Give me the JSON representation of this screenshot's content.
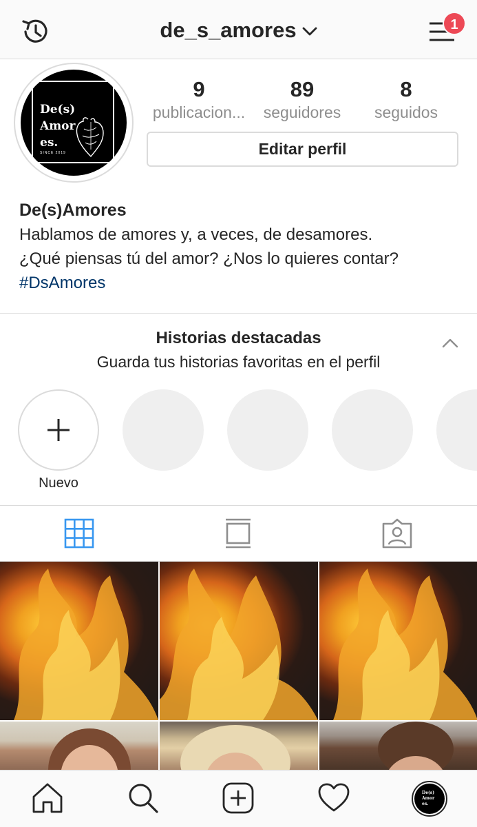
{
  "header": {
    "username": "de_s_amores",
    "notification_count": "1"
  },
  "profile": {
    "avatar_text_line1": "De(s)",
    "avatar_text_line2": "Amor",
    "avatar_text_line3": "es.",
    "avatar_since": "SINCE 2019",
    "stats": [
      {
        "value": "9",
        "label": "publicacion..."
      },
      {
        "value": "89",
        "label": "seguidores"
      },
      {
        "value": "8",
        "label": "seguidos"
      }
    ],
    "edit_button_label": "Editar perfil",
    "name": "De(s)Amores",
    "bio_line1": "Hablamos de amores y, a veces, de desamores.",
    "bio_line2": "¿Qué piensas tú del amor? ¿Nos lo quieres contar?",
    "hashtag": "#DsAmores"
  },
  "highlights": {
    "title": "Historias destacadas",
    "subtitle": "Guarda tus historias favoritas en el perfil",
    "new_label": "Nuevo"
  },
  "tabs": [
    {
      "icon": "grid-icon",
      "active": true
    },
    {
      "icon": "feed-icon",
      "active": false
    },
    {
      "icon": "tagged-icon",
      "active": false
    }
  ],
  "colors": {
    "accent_blue": "#3897f0",
    "badge_red": "#ed4956",
    "hashtag": "#003569"
  },
  "bottom_nav": [
    "home-icon",
    "search-icon",
    "add-post-icon",
    "heart-icon",
    "profile-avatar"
  ]
}
